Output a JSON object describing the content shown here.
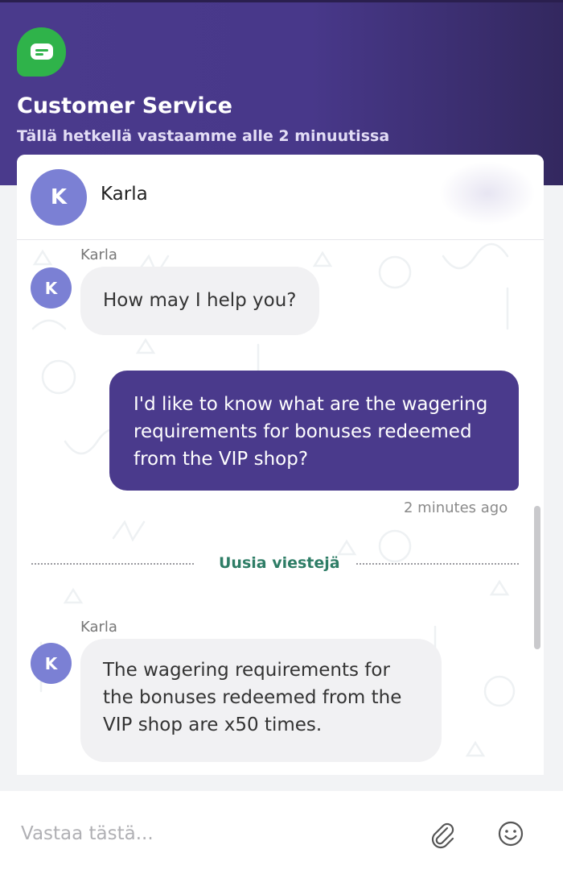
{
  "header": {
    "title": "Customer Service",
    "subtitle": "Tällä hetkellä vastaamme alle 2 minuutissa"
  },
  "agent": {
    "name": "Karla",
    "initial": "K"
  },
  "messages": [
    {
      "from": "agent",
      "sender": "Karla",
      "text": "How may I help you?"
    },
    {
      "from": "user",
      "lines": [
        "I'd like to know what are the wagering",
        "requirements for bonuses redeemed",
        "from the VIP shop?"
      ],
      "time": "2 minutes ago"
    },
    {
      "from": "agent",
      "sender": "Karla",
      "lines": [
        "The wagering requirements for",
        "the bonuses redeemed from the",
        "VIP shop are x50 times."
      ]
    }
  ],
  "divider": {
    "label": "Uusia viestejä"
  },
  "composer": {
    "placeholder": "Vastaa tästä...",
    "value": ""
  },
  "icons": {
    "logo": "chat-bubble-icon",
    "attach": "paperclip-icon",
    "emoji": "smiley-icon"
  },
  "colors": {
    "header": "#4a3a8c",
    "logo": "#2fb34a",
    "avatar": "#7b80d4",
    "outgoing_bubble": "#4a3a8c",
    "incoming_bubble": "#f1f1f3",
    "divider_label": "#2e7d66"
  }
}
